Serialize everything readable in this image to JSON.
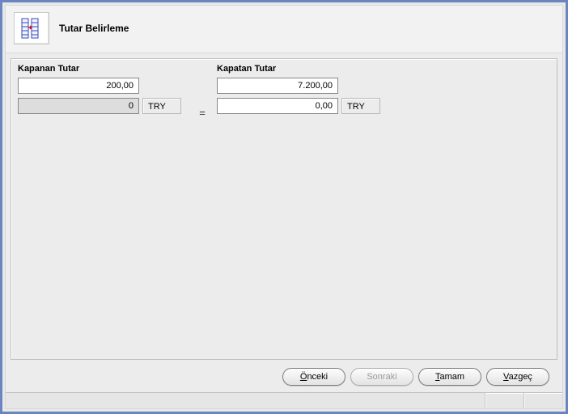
{
  "header": {
    "title": "Tutar Belirleme"
  },
  "left": {
    "label": "Kapanan Tutar",
    "amount1": "200,00",
    "amount2": "0",
    "currency": "TRY"
  },
  "eq": "=",
  "right": {
    "label": "Kapatan Tutar",
    "amount1": "7.200,00",
    "amount2": "0,00",
    "currency": "TRY"
  },
  "buttons": {
    "prev": "Önceki",
    "next": "Sonraki",
    "ok": "Tamam",
    "cancel": "Vazgeç",
    "ul": {
      "prev": "Ö",
      "ok": "T",
      "cancel": "V"
    }
  }
}
